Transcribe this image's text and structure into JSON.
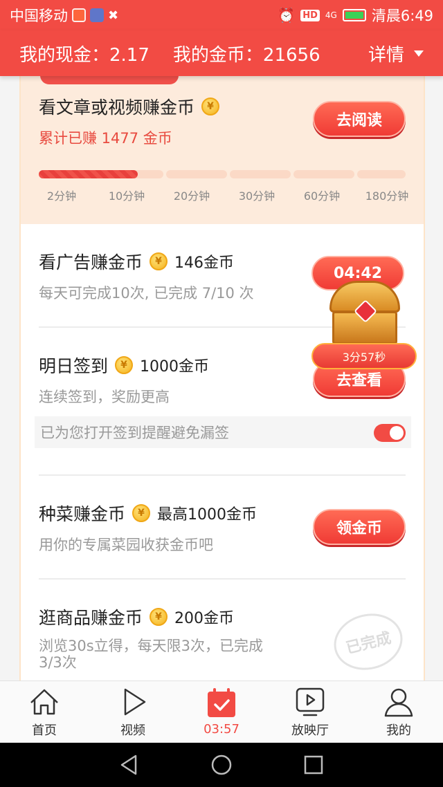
{
  "status_bar": {
    "carrier": "中国移动",
    "network": "4G",
    "time": "清晨6:49"
  },
  "header": {
    "cash_label": "我的现金：2.17",
    "coins_label": "我的金币：21656",
    "detail_label": "详情"
  },
  "tasks": {
    "read": {
      "title": "看文章或视频赚金币",
      "subtitle": "累计已赚 1477 金币",
      "button": "去阅读",
      "progress_fraction": 0.27,
      "ticks": [
        "2分钟",
        "10分钟",
        "20分钟",
        "30分钟",
        "60分钟",
        "180分钟"
      ]
    },
    "ads": {
      "title": "看广告赚金币",
      "reward": "146金币",
      "subtitle": "每天可完成10次, 已完成 7/10 次"
    },
    "signin": {
      "title": "明日签到",
      "reward": "1000金币",
      "subtitle": "连续签到，奖励更高",
      "button": "去查看",
      "notice": "已为您打开签到提醒避免漏签",
      "reminder_on": true
    },
    "farm": {
      "title": "种菜赚金币",
      "reward": "最高1000金币",
      "subtitle": "用你的专属菜园收获金币吧",
      "button": "领金币"
    },
    "shop": {
      "title": "逛商品赚金币",
      "reward": "200金币",
      "subtitle_line1": "浏览30s立得，每天限3次，已完成",
      "subtitle_line2": "3/3次",
      "stamp": "已完成"
    }
  },
  "chest": {
    "timer": "04:42",
    "label": "3分57秒"
  },
  "bottom_nav": {
    "items": [
      {
        "label": "首页",
        "icon": "home-icon"
      },
      {
        "label": "视频",
        "icon": "play-icon"
      },
      {
        "label": "03:57",
        "icon": "calendar-check-icon",
        "active": true
      },
      {
        "label": "放映厅",
        "icon": "screen-play-icon"
      },
      {
        "label": "我的",
        "icon": "user-icon"
      }
    ]
  },
  "colors": {
    "brand": "#f24b44",
    "coin": "#f5b21d",
    "top_section_bg": "#fdebdc"
  }
}
